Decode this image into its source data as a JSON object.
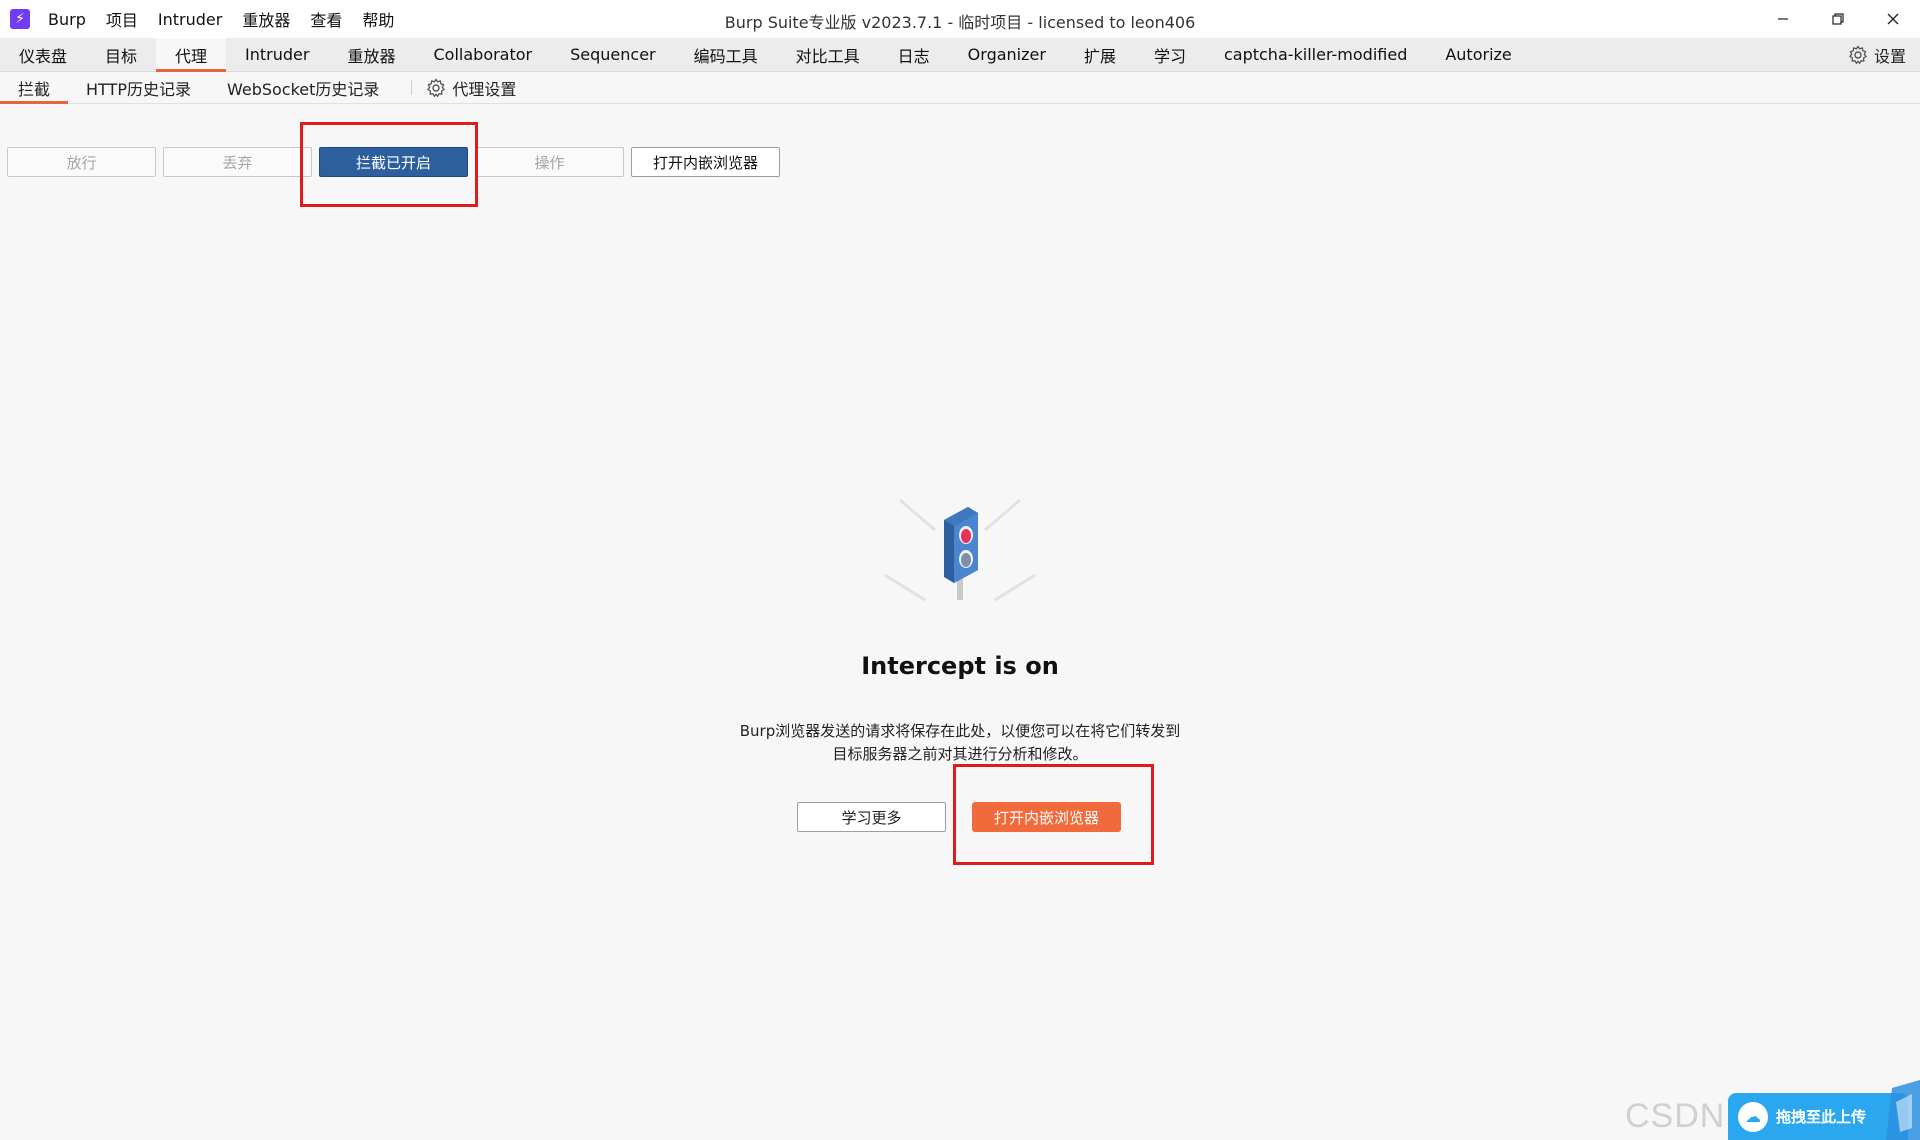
{
  "app": {
    "logo_glyph": "⚡",
    "window_title": "Burp Suite专业版  v2023.7.1 - 临时项目 - licensed to leon406",
    "accent_color": "#e8643d",
    "brand_color": "#6f3df5"
  },
  "menubar": [
    "Burp",
    "项目",
    "Intruder",
    "重放器",
    "查看",
    "帮助"
  ],
  "main_tabs": {
    "items": [
      "仪表盘",
      "目标",
      "代理",
      "Intruder",
      "重放器",
      "Collaborator",
      "Sequencer",
      "编码工具",
      "对比工具",
      "日志",
      "Organizer",
      "扩展",
      "学习",
      "captcha-killer-modified",
      "Autorize"
    ],
    "active": "代理",
    "settings_label": "设置"
  },
  "sub_tabs": {
    "items": [
      "拦截",
      "HTTP历史记录",
      "WebSocket历史记录"
    ],
    "active": "拦截",
    "proxy_settings_label": "代理设置"
  },
  "toolbar": {
    "forward_label": "放行",
    "drop_label": "丢弃",
    "intercept_label": "拦截已开启",
    "action_label": "操作",
    "open_browser_label": "打开内嵌浏览器"
  },
  "center": {
    "title": "Intercept is on",
    "description_line1": "Burp浏览器发送的请求将保存在此处，以便您可以在将它们转发到",
    "description_line2": "目标服务器之前对其进行分析和修改。",
    "learn_more_label": "学习更多",
    "open_browser_label": "打开内嵌浏览器"
  },
  "watermark": {
    "text": "CSDN @点点开心",
    "upload_label": "拖拽至此上传"
  },
  "icons": {
    "logo": "burp-logo-icon",
    "minimize": "minimize-icon",
    "restore": "restore-icon",
    "close": "close-icon",
    "settings": "gear-icon",
    "traffic_light": "traffic-light-icon"
  }
}
